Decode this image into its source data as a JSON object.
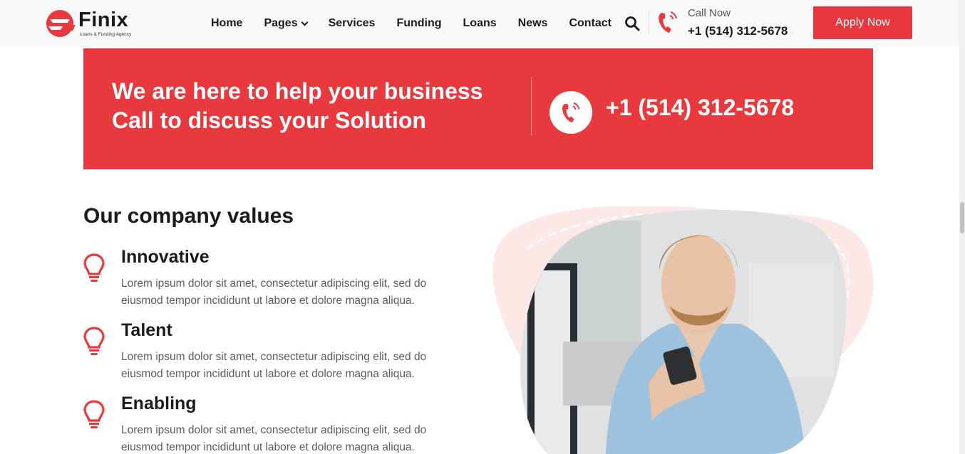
{
  "header": {
    "logo_text": "Finix",
    "logo_tagline": "Loans & Funding Agency",
    "nav": [
      {
        "label": "Home",
        "has_dropdown": false
      },
      {
        "label": "Pages",
        "has_dropdown": true
      },
      {
        "label": "Services",
        "has_dropdown": false
      },
      {
        "label": "Funding",
        "has_dropdown": false
      },
      {
        "label": "Loans",
        "has_dropdown": false
      },
      {
        "label": "News",
        "has_dropdown": false
      },
      {
        "label": "Contact",
        "has_dropdown": false
      }
    ],
    "call_label": "Call Now",
    "call_number": "+1 (514) 312-5678",
    "apply_label": "Apply Now"
  },
  "banner": {
    "line1": "We are here to help your business",
    "line2": "Call to discuss your Solution",
    "phone": "+1 (514) 312-5678"
  },
  "values": {
    "title": "Our company values",
    "items": [
      {
        "title": "Innovative",
        "desc": "Lorem ipsum dolor sit amet, consectetur adipiscing elit, sed do eiusmod tempor incididunt ut labore et dolore magna aliqua."
      },
      {
        "title": "Talent",
        "desc": "Lorem ipsum dolor sit amet, consectetur adipiscing elit, sed do eiusmod tempor incididunt ut labore et dolore magna aliqua."
      },
      {
        "title": "Enabling",
        "desc": "Lorem ipsum dolor sit amet, consectetur adipiscing elit, sed do eiusmod tempor incididunt ut labore et dolore magna aliqua."
      }
    ]
  },
  "colors": {
    "accent": "#e8393e",
    "blob": "#fde8e8",
    "text_dark": "#1b1b1b",
    "text_muted": "#5b5b5b"
  },
  "icons": {
    "logo": "finix-logo-icon",
    "search": "search-icon",
    "call": "phone-ringing-icon",
    "value": "lightbulb-icon"
  }
}
